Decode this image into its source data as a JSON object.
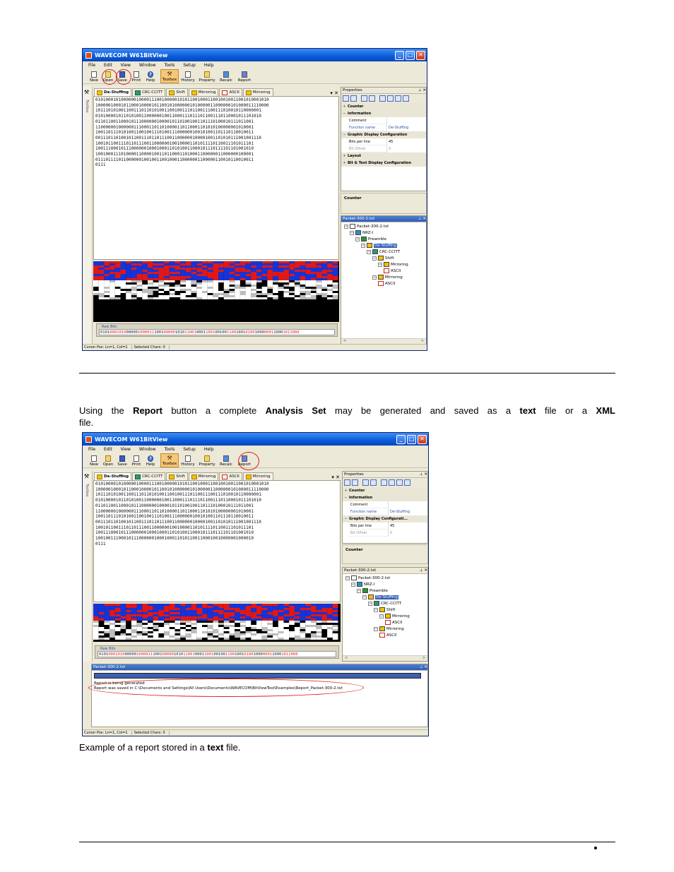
{
  "app": {
    "title": "WAVECOM W61BitView",
    "menu": [
      "File",
      "Edit",
      "View",
      "Window",
      "Tools",
      "Setup",
      "Help"
    ],
    "toolbar1": [
      "New",
      "Open",
      "Save",
      "Print",
      "Help",
      "Toolbox",
      "History",
      "Property",
      "Recalc",
      "Report"
    ],
    "tabs": [
      "De-Stuffing",
      "CRC-CCITT",
      "Shift",
      "Mirroring",
      "ASCII",
      "Mirroring"
    ],
    "toolbox_label": "Toolbox",
    "bits": "01010001010000001000011100100000101011001000110010010011001010001010\n10000010001011000100001011001010000001010000011000000101000011110000\n10111010100110011101101010011001001110110011100111010010110000001\n01010000101101010011000000100110001110111011001110110001011101010\n01101100110001011100000010000101101001001101110100010111011001\n11000000100000011100011011010000110110001101010100000001010001\n10011011101010011001001110100111000000100101001101110110010011\n00111011010010110011101101110011000000100001001101010111001001110\n10010110011101101110011000000100100001101011110110011101011101\n10011100010111000000100010001101010011000101110111101101001010\n10010001110100001100001001101100011010001100000011000000100001\n01110111101100000010010011001000110000001100000110010110010011\n0111",
    "bits2": "01010000101000001000011100100000101011001000110010010011001010001010\n10000010001011000100001011001010000001010000011000000101000011110000\n10111010100110011101101010011001001110110011100111010010110000001\n01010000101101010011000000100110001110111011001110110001011101010\n01101100110001011100000010000101101001001101110100010111011001\n11000000100000011100011011010000110110001101010100000001010001\n10011011101010011001001110100111000000100101001101110110010011\n00111011010010110011101101110011000000100001001101010111001001110\n10010110011101101110011000000100100001101011110110011101011101\n10011100010111000000100010001101010011000101110111101101001010\n10010011100010111000000100010001101011001100010010000001000010\n0111",
    "raw_bits_label": "Raw Bits",
    "raw_bits": [
      "0101",
      "0001010",
      "00000",
      "1000011",
      "1001",
      "00000",
      "1010",
      "11001",
      "0001",
      "1001",
      "00100",
      "1100",
      "1001",
      "0100",
      "1000",
      "0001",
      "1000",
      "1011000"
    ],
    "properties": {
      "header": "Properties",
      "rows": [
        {
          "type": "cat",
          "label": "Counter"
        },
        {
          "type": "cat",
          "label": "Information"
        },
        {
          "type": "row",
          "k": "Comment",
          "v": ""
        },
        {
          "type": "row",
          "k": "Function name",
          "v": "De-Stuffing",
          "style": "blue"
        },
        {
          "type": "cat",
          "label": "Graphic Display Configuration"
        },
        {
          "type": "row",
          "k": "Bits per line",
          "v": "45"
        },
        {
          "type": "row",
          "k": "Bit Offset",
          "v": "0",
          "style": "gray"
        },
        {
          "type": "cat",
          "label": "Layout"
        },
        {
          "type": "cat",
          "label": "Bit & Text Display Configuration"
        }
      ],
      "rows2": [
        {
          "type": "cat",
          "label": "Counter"
        },
        {
          "type": "cat",
          "label": "Information"
        },
        {
          "type": "row",
          "k": "Comment",
          "v": ""
        },
        {
          "type": "row",
          "k": "Function name",
          "v": "De-Stuffing",
          "style": "blue"
        },
        {
          "type": "cat",
          "label": "Graphic Display Configurati..."
        },
        {
          "type": "row",
          "k": "Bits per line",
          "v": "45"
        },
        {
          "type": "row",
          "k": "Bit Offset",
          "v": "0",
          "style": "gray"
        }
      ],
      "description": "Counter"
    },
    "tree": {
      "header": "Packet-300-2.txt",
      "nodes": [
        {
          "label": "Packet-300-2.txt",
          "icon": "file"
        },
        {
          "label": "NRZ-I",
          "icon": "nrz"
        },
        {
          "label": "Preamble",
          "icon": "pre"
        },
        {
          "label": "De-Stuffing",
          "icon": "ds"
        },
        {
          "label": "CRC-CCITT",
          "icon": "crc"
        },
        {
          "label": "Shift",
          "icon": "ds"
        },
        {
          "label": "Mirroring",
          "icon": "ds"
        },
        {
          "label": "ASCII",
          "icon": "asc"
        },
        {
          "label": "Mirroring",
          "icon": "ds"
        },
        {
          "label": "ASCII",
          "icon": "asc"
        }
      ]
    },
    "status": {
      "cursor": "Cursor Pos: Ln=1, Col=1",
      "selected": "Selected Chars: 0"
    },
    "output": {
      "header": "Packet-300-2.txt",
      "line1": "Report is being generated",
      "line2": "Report was saved in C:\\Documents and Settings\\All Users\\Documents\\WAVECOM\\BitViewTool\\Examples\\Report_Packet-300-2.txt"
    }
  },
  "doc": {
    "p1": {
      "t1": "Using the ",
      "b1": "Report",
      "t2": " button a complete ",
      "b2": "Analysis Set",
      "t3": " may be generated and saved as a ",
      "b3": "text",
      "t4": " file or a ",
      "b4": "XML",
      "t5": "file."
    },
    "p2": {
      "t1": "Example of a report stored in a ",
      "b1": "text",
      "t2": " file."
    }
  }
}
